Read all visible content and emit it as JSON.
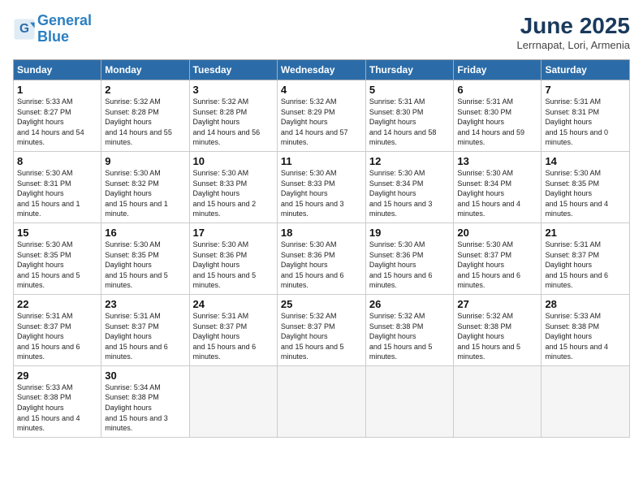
{
  "header": {
    "logo_line1": "General",
    "logo_line2": "Blue",
    "month_title": "June 2025",
    "location": "Lerrnapat, Lori, Armenia"
  },
  "days_of_week": [
    "Sunday",
    "Monday",
    "Tuesday",
    "Wednesday",
    "Thursday",
    "Friday",
    "Saturday"
  ],
  "weeks": [
    [
      {
        "day": "1",
        "sunrise": "5:33 AM",
        "sunset": "8:27 PM",
        "daylight": "14 hours and 54 minutes."
      },
      {
        "day": "2",
        "sunrise": "5:32 AM",
        "sunset": "8:28 PM",
        "daylight": "14 hours and 55 minutes."
      },
      {
        "day": "3",
        "sunrise": "5:32 AM",
        "sunset": "8:28 PM",
        "daylight": "14 hours and 56 minutes."
      },
      {
        "day": "4",
        "sunrise": "5:32 AM",
        "sunset": "8:29 PM",
        "daylight": "14 hours and 57 minutes."
      },
      {
        "day": "5",
        "sunrise": "5:31 AM",
        "sunset": "8:30 PM",
        "daylight": "14 hours and 58 minutes."
      },
      {
        "day": "6",
        "sunrise": "5:31 AM",
        "sunset": "8:30 PM",
        "daylight": "14 hours and 59 minutes."
      },
      {
        "day": "7",
        "sunrise": "5:31 AM",
        "sunset": "8:31 PM",
        "daylight": "15 hours and 0 minutes."
      }
    ],
    [
      {
        "day": "8",
        "sunrise": "5:30 AM",
        "sunset": "8:31 PM",
        "daylight": "15 hours and 1 minute."
      },
      {
        "day": "9",
        "sunrise": "5:30 AM",
        "sunset": "8:32 PM",
        "daylight": "15 hours and 1 minute."
      },
      {
        "day": "10",
        "sunrise": "5:30 AM",
        "sunset": "8:33 PM",
        "daylight": "15 hours and 2 minutes."
      },
      {
        "day": "11",
        "sunrise": "5:30 AM",
        "sunset": "8:33 PM",
        "daylight": "15 hours and 3 minutes."
      },
      {
        "day": "12",
        "sunrise": "5:30 AM",
        "sunset": "8:34 PM",
        "daylight": "15 hours and 3 minutes."
      },
      {
        "day": "13",
        "sunrise": "5:30 AM",
        "sunset": "8:34 PM",
        "daylight": "15 hours and 4 minutes."
      },
      {
        "day": "14",
        "sunrise": "5:30 AM",
        "sunset": "8:35 PM",
        "daylight": "15 hours and 4 minutes."
      }
    ],
    [
      {
        "day": "15",
        "sunrise": "5:30 AM",
        "sunset": "8:35 PM",
        "daylight": "15 hours and 5 minutes."
      },
      {
        "day": "16",
        "sunrise": "5:30 AM",
        "sunset": "8:35 PM",
        "daylight": "15 hours and 5 minutes."
      },
      {
        "day": "17",
        "sunrise": "5:30 AM",
        "sunset": "8:36 PM",
        "daylight": "15 hours and 5 minutes."
      },
      {
        "day": "18",
        "sunrise": "5:30 AM",
        "sunset": "8:36 PM",
        "daylight": "15 hours and 6 minutes."
      },
      {
        "day": "19",
        "sunrise": "5:30 AM",
        "sunset": "8:36 PM",
        "daylight": "15 hours and 6 minutes."
      },
      {
        "day": "20",
        "sunrise": "5:30 AM",
        "sunset": "8:37 PM",
        "daylight": "15 hours and 6 minutes."
      },
      {
        "day": "21",
        "sunrise": "5:31 AM",
        "sunset": "8:37 PM",
        "daylight": "15 hours and 6 minutes."
      }
    ],
    [
      {
        "day": "22",
        "sunrise": "5:31 AM",
        "sunset": "8:37 PM",
        "daylight": "15 hours and 6 minutes."
      },
      {
        "day": "23",
        "sunrise": "5:31 AM",
        "sunset": "8:37 PM",
        "daylight": "15 hours and 6 minutes."
      },
      {
        "day": "24",
        "sunrise": "5:31 AM",
        "sunset": "8:37 PM",
        "daylight": "15 hours and 6 minutes."
      },
      {
        "day": "25",
        "sunrise": "5:32 AM",
        "sunset": "8:37 PM",
        "daylight": "15 hours and 5 minutes."
      },
      {
        "day": "26",
        "sunrise": "5:32 AM",
        "sunset": "8:38 PM",
        "daylight": "15 hours and 5 minutes."
      },
      {
        "day": "27",
        "sunrise": "5:32 AM",
        "sunset": "8:38 PM",
        "daylight": "15 hours and 5 minutes."
      },
      {
        "day": "28",
        "sunrise": "5:33 AM",
        "sunset": "8:38 PM",
        "daylight": "15 hours and 4 minutes."
      }
    ],
    [
      {
        "day": "29",
        "sunrise": "5:33 AM",
        "sunset": "8:38 PM",
        "daylight": "15 hours and 4 minutes."
      },
      {
        "day": "30",
        "sunrise": "5:34 AM",
        "sunset": "8:38 PM",
        "daylight": "15 hours and 3 minutes."
      },
      null,
      null,
      null,
      null,
      null
    ]
  ],
  "labels": {
    "sunrise": "Sunrise:",
    "sunset": "Sunset:",
    "daylight": "Daylight hours"
  }
}
